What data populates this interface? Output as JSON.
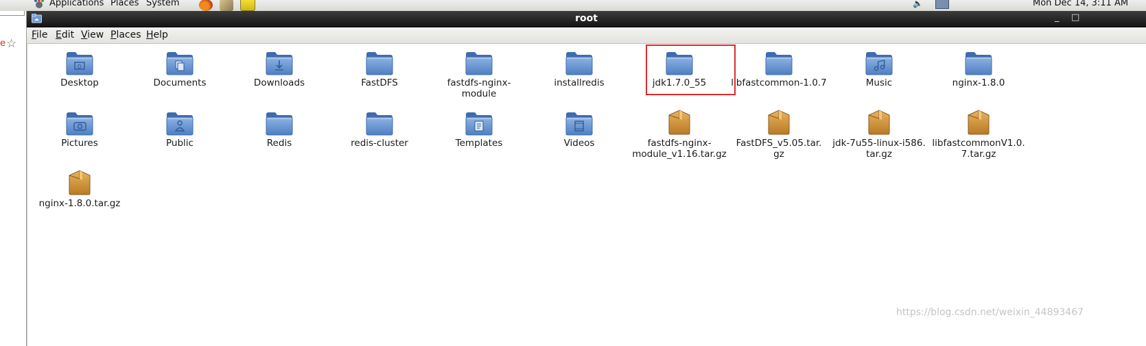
{
  "top_panel": {
    "menus": [
      "Applications",
      "Places",
      "System"
    ],
    "clock": "Mon Dec 14,  3:11 AM"
  },
  "window": {
    "title": "root",
    "menubar": [
      {
        "pre": "",
        "mnemonic": "F",
        "post": "ile"
      },
      {
        "pre": "",
        "mnemonic": "E",
        "post": "dit"
      },
      {
        "pre": "",
        "mnemonic": "V",
        "post": "iew"
      },
      {
        "pre": "",
        "mnemonic": "P",
        "post": "laces"
      },
      {
        "pre": "",
        "mnemonic": "H",
        "post": "elp"
      }
    ],
    "controls": [
      "_",
      "□"
    ]
  },
  "files": [
    {
      "name": "Desktop",
      "type": "folder",
      "emblem": "desktop-emblem",
      "color": "#5b8bc9"
    },
    {
      "name": "Documents",
      "type": "folder",
      "emblem": "documents-emblem",
      "color": "#5b8bc9"
    },
    {
      "name": "Downloads",
      "type": "folder",
      "emblem": "downloads-emblem",
      "color": "#5b8bc9"
    },
    {
      "name": "FastDFS",
      "type": "folder",
      "emblem": "",
      "color": "#5b8bc9"
    },
    {
      "name": "fastdfs-nginx-\nmodule",
      "type": "folder",
      "emblem": "",
      "color": "#5b8bc9"
    },
    {
      "name": "installredis",
      "type": "folder",
      "emblem": "",
      "color": "#5b8bc9"
    },
    {
      "name": "jdk1.7.0_55",
      "type": "folder",
      "emblem": "",
      "color": "#5b8bc9"
    },
    {
      "name": "libfastcommon-1.0.7",
      "type": "folder",
      "emblem": "",
      "color": "#5b8bc9"
    },
    {
      "name": "Music",
      "type": "folder",
      "emblem": "music-emblem",
      "color": "#5b8bc9"
    },
    {
      "name": "nginx-1.8.0",
      "type": "folder",
      "emblem": "",
      "color": "#5b8bc9"
    },
    {
      "name": "Pictures",
      "type": "folder",
      "emblem": "pictures-emblem",
      "color": "#5b8bc9"
    },
    {
      "name": "Public",
      "type": "folder",
      "emblem": "public-emblem",
      "color": "#5b8bc9"
    },
    {
      "name": "Redis",
      "type": "folder",
      "emblem": "",
      "color": "#5b8bc9"
    },
    {
      "name": "redis-cluster",
      "type": "folder",
      "emblem": "",
      "color": "#5b8bc9"
    },
    {
      "name": "Templates",
      "type": "folder",
      "emblem": "templates-emblem",
      "color": "#5b8bc9"
    },
    {
      "name": "Videos",
      "type": "folder",
      "emblem": "videos-emblem",
      "color": "#5b8bc9"
    },
    {
      "name": "fastdfs-nginx-\nmodule_v1.16.tar.gz",
      "type": "archive",
      "emblem": "",
      "color": "#d69a3f"
    },
    {
      "name": "FastDFS_v5.05.tar.\ngz",
      "type": "archive",
      "emblem": "",
      "color": "#d69a3f"
    },
    {
      "name": "jdk-7u55-linux-i586.\ntar.gz",
      "type": "archive",
      "emblem": "",
      "color": "#d69a3f"
    },
    {
      "name": "libfastcommonV1.0.\n7.tar.gz",
      "type": "archive",
      "emblem": "",
      "color": "#d69a3f"
    },
    {
      "name": "nginx-1.8.0.tar.gz",
      "type": "archive",
      "emblem": "",
      "color": "#d69a3f"
    }
  ],
  "highlighted": "jdk1.7.0_55",
  "highlight_color": "#e0292a",
  "watermark": "https://blog.csdn.net/weixin_44893467"
}
